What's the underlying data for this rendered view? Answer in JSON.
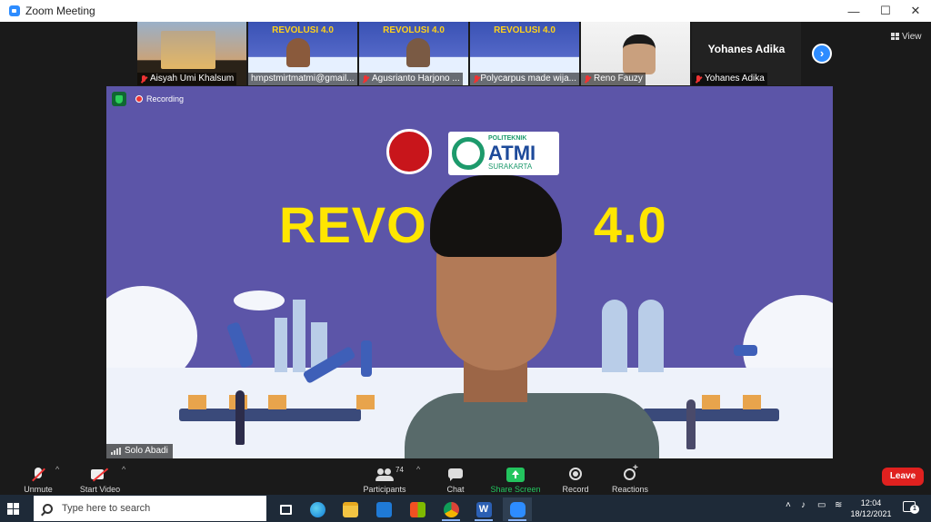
{
  "window": {
    "title": "Zoom Meeting",
    "controls": {
      "minimize": "—",
      "maximize": "☐",
      "close": "✕"
    }
  },
  "gallery": {
    "participants": [
      {
        "name": "Aisyah Umi Khalsum"
      },
      {
        "name": "hmpstmirtmatmi@gmail...",
        "poster_title": "REVOLUSI 4.0"
      },
      {
        "name": "Agusrianto Harjono ...",
        "poster_title": "REVOLUSI 4.0"
      },
      {
        "name": "Polycarpus made wija...",
        "poster_title": "REVOLUSI 4.0"
      },
      {
        "name": "Reno Fauzy"
      },
      {
        "name": "Yohanes Adika",
        "display_name": "Yohanes Adika"
      }
    ],
    "next_icon": "chevron-right-icon",
    "view_label": "View"
  },
  "main_video": {
    "recording_label": "Recording",
    "slide_title": "REVO",
    "slide_title_tail": "4.0",
    "logo_text": {
      "top": "POLITEKNIK",
      "main": "ATMI",
      "bottom": "SURAKARTA"
    },
    "speaker_name": "Solo Abadi"
  },
  "toolbar": {
    "unmute": "Unmute",
    "start_video": "Start Video",
    "participants": "Participants",
    "participant_count": "74",
    "chat": "Chat",
    "share_screen": "Share Screen",
    "record": "Record",
    "reactions": "Reactions",
    "leave": "Leave",
    "caret": "^"
  },
  "taskbar": {
    "search_placeholder": "Type here to search",
    "time": "12:04",
    "date": "18/12/2021",
    "notification_count": "1",
    "apps": [
      "task-view-icon",
      "edge-icon",
      "file-explorer-icon",
      "mail-icon",
      "store-icon",
      "chrome-icon",
      "word-icon",
      "zoom-icon"
    ]
  },
  "colors": {
    "zoom_blue": "#2d8cff",
    "share_green": "#23c45e",
    "leave_red": "#e0211f",
    "slide_bg": "#5c55a8",
    "slide_title": "#ffe600"
  }
}
